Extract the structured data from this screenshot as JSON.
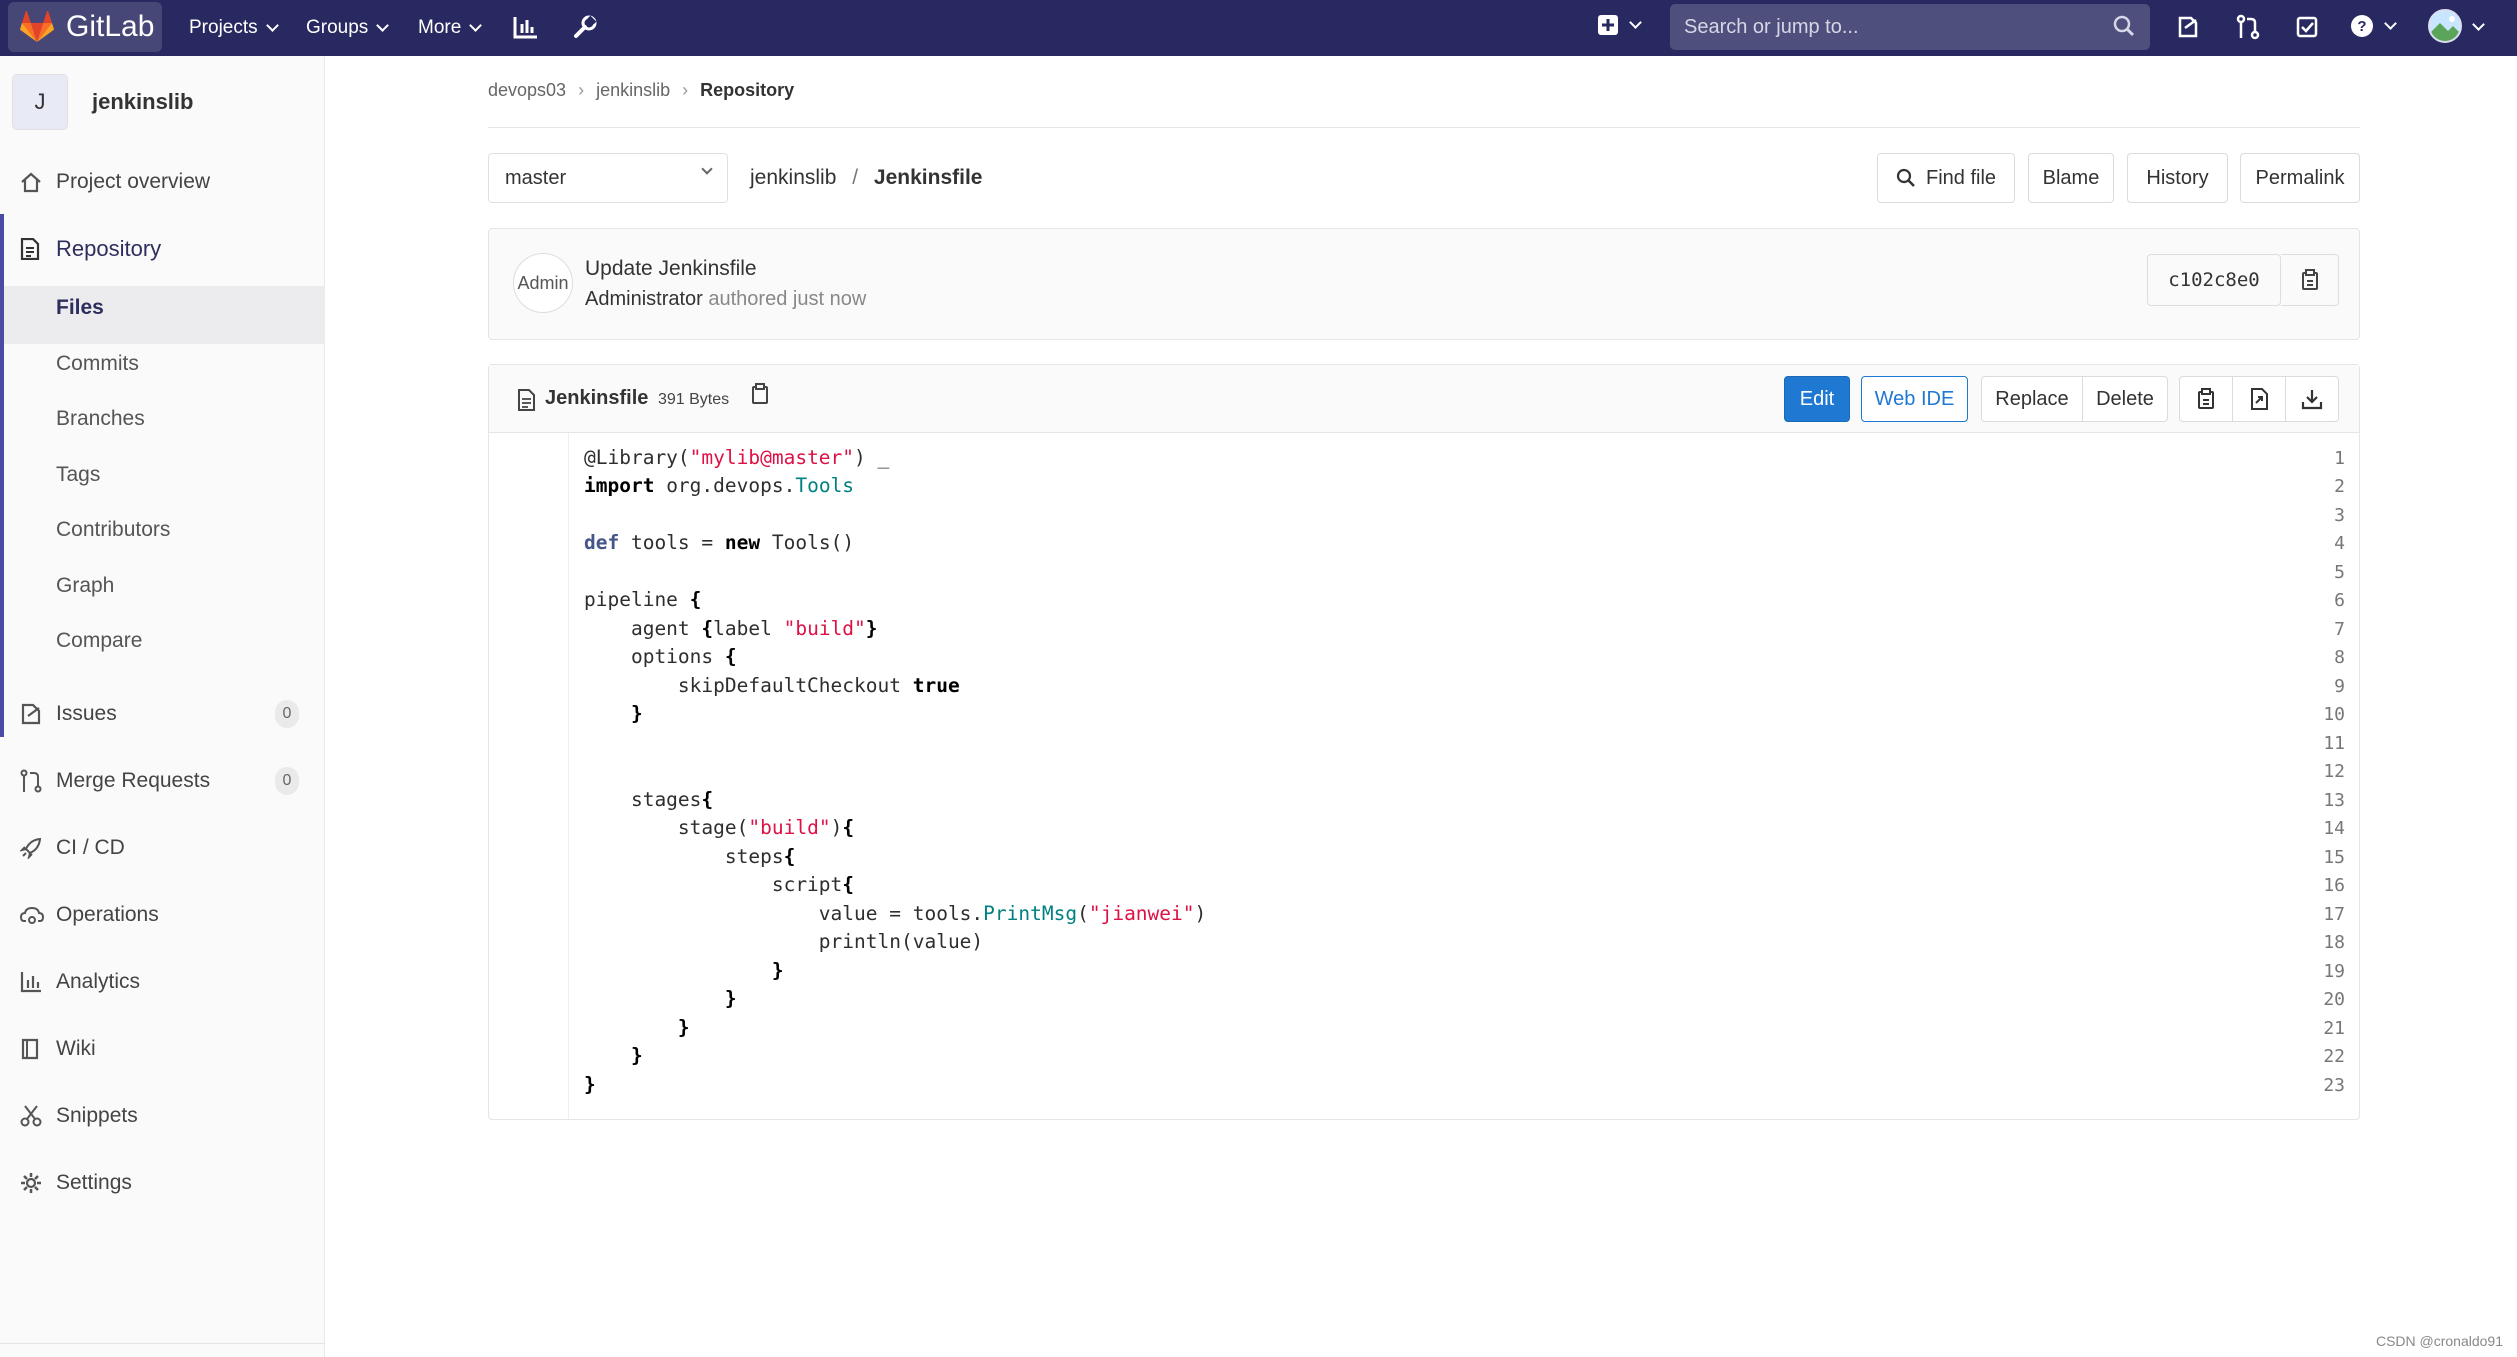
{
  "topbar": {
    "app_name": "GitLab",
    "nav": [
      "Projects",
      "Groups",
      "More"
    ],
    "search_placeholder": "Search or jump to..."
  },
  "sidebar": {
    "project_initial": "J",
    "project_name": "jenkinslib",
    "items": {
      "overview": "Project overview",
      "repository": "Repository",
      "issues": "Issues",
      "merge_requests": "Merge Requests",
      "cicd": "CI / CD",
      "operations": "Operations",
      "analytics": "Analytics",
      "wiki": "Wiki",
      "snippets": "Snippets",
      "settings": "Settings"
    },
    "repo_sub": [
      "Files",
      "Commits",
      "Branches",
      "Tags",
      "Contributors",
      "Graph",
      "Compare"
    ],
    "issues_count": "0",
    "mr_count": "0"
  },
  "breadcrumb": [
    "devops03",
    "jenkinslib",
    "Repository"
  ],
  "file_bar": {
    "branch": "master",
    "path_root": "jenkinslib",
    "path_sep": "/",
    "path_file": "Jenkinsfile",
    "buttons": {
      "find": "Find file",
      "blame": "Blame",
      "history": "History",
      "permalink": "Permalink"
    }
  },
  "commit": {
    "avatar_alt": "Admin",
    "title": "Update Jenkinsfile",
    "author": "Administrator",
    "time": "authored just now",
    "sha": "c102c8e0"
  },
  "file": {
    "name": "Jenkinsfile",
    "size": "391 Bytes",
    "buttons": {
      "edit": "Edit",
      "webide": "Web IDE",
      "replace": "Replace",
      "delete": "Delete"
    }
  },
  "code_lines": [
    "@Library(\"mylib@master\") _",
    "import org.devops.Tools",
    "",
    "def tools = new Tools()",
    "",
    "pipeline {",
    "    agent {label \"build\"}",
    "    options {",
    "        skipDefaultCheckout true",
    "    }",
    "",
    "",
    "    stages{",
    "        stage(\"build\"){",
    "            steps{",
    "                script{",
    "                    value = tools.PrintMsg(\"jianwei\")",
    "                    println(value)",
    "                }",
    "            }",
    "        }",
    "    }",
    "}"
  ],
  "colors": {
    "topbar": "#292961",
    "primary": "#1f78d1",
    "sidebar_active": "#4b4ba3"
  },
  "watermark": "CSDN @cronaldo91"
}
